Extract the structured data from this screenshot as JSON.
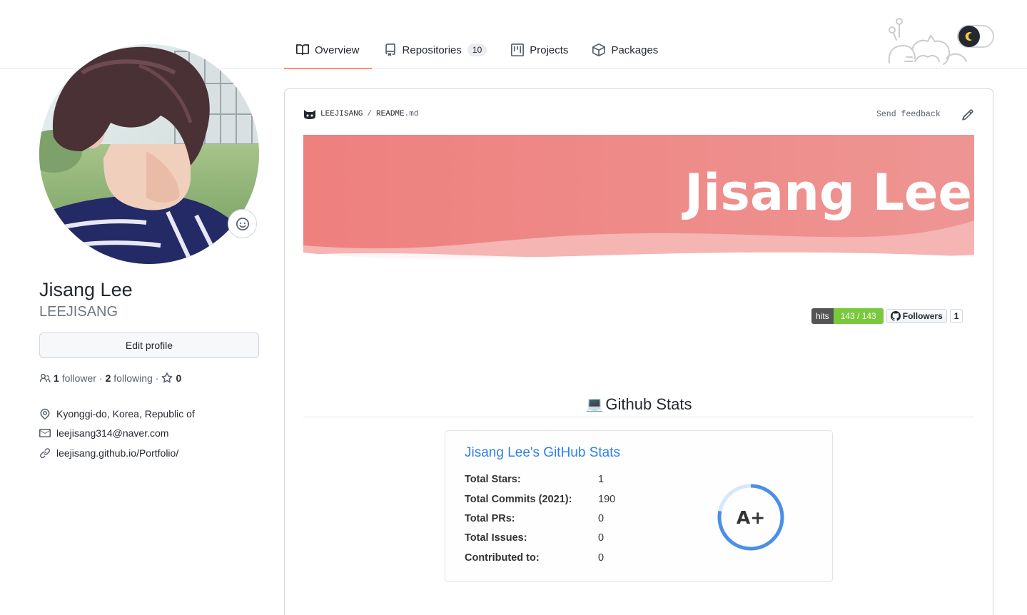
{
  "nav": {
    "tabs": [
      {
        "label": "Overview",
        "icon": "book-icon",
        "active": true
      },
      {
        "label": "Repositories",
        "icon": "repo-icon",
        "count": "10"
      },
      {
        "label": "Projects",
        "icon": "project-icon"
      },
      {
        "label": "Packages",
        "icon": "package-icon"
      }
    ],
    "theme_toggle_icon": "moon-icon"
  },
  "profile": {
    "name": "Jisang Lee",
    "login": "LEEJISANG",
    "edit_label": "Edit profile",
    "followers_count": "1",
    "followers_label": "follower",
    "following_count": "2",
    "following_label": "following",
    "stars_count": "0",
    "dot": "·",
    "location": "Kyonggi-do, Korea, Republic of",
    "email": "leejisang314@naver.com",
    "website": "leejisang.github.io/Portfolio/"
  },
  "readme": {
    "owner": "LEEJISANG",
    "slash": "/",
    "file_base": "README",
    "file_ext": ".md",
    "feedback_label": "Send feedback",
    "banner_text": "Jisang Lee",
    "hits_label": "hits",
    "hits_value": "143 / 143",
    "followers_badge_label": "Followers",
    "followers_badge_count": "1",
    "stats_heading_emoji": "💻",
    "stats_heading": "Github Stats"
  },
  "stats": {
    "title": "Jisang Lee's GitHub Stats",
    "rows": [
      {
        "label": "Total Stars:",
        "value": "1"
      },
      {
        "label": "Total Commits (2021):",
        "value": "190"
      },
      {
        "label": "Total PRs:",
        "value": "0"
      },
      {
        "label": "Total Issues:",
        "value": "0"
      },
      {
        "label": "Contributed to:",
        "value": "0"
      }
    ],
    "rank": "A+",
    "rank_progress": 0.78
  },
  "colors": {
    "accent_tab": "#fd8c73",
    "banner": "#ef8884",
    "stats_title": "#2f80ed",
    "hits_green": "#79c83d"
  }
}
